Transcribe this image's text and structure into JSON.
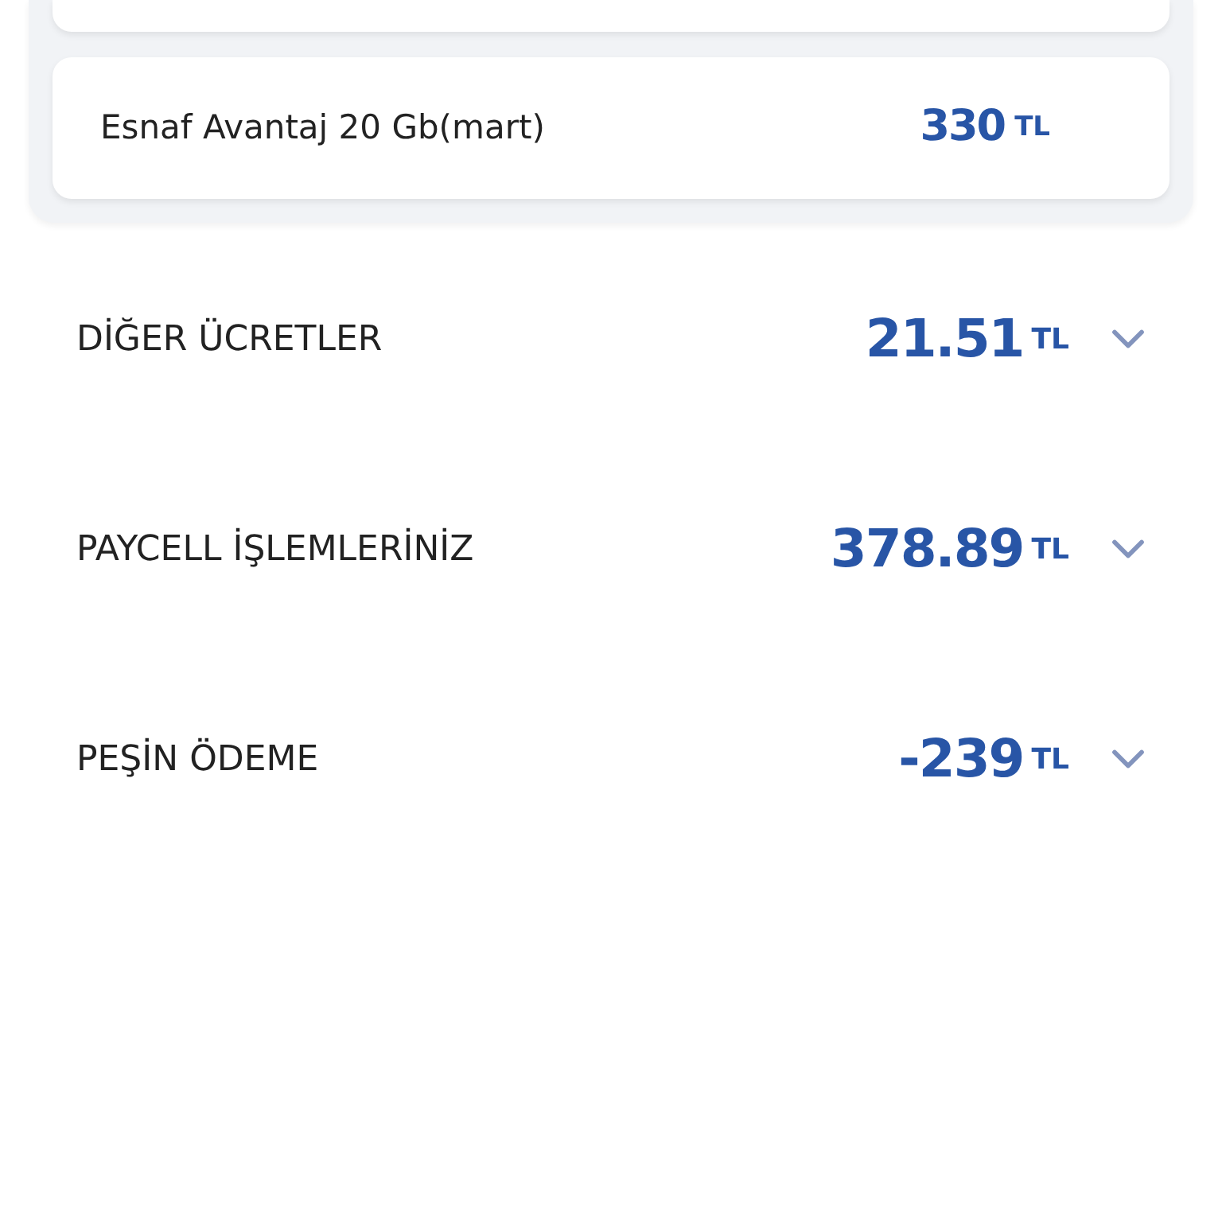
{
  "package": {
    "name": "Esnaf Avantaj 20 Gb(mart)",
    "amount": "330",
    "currency": "TL"
  },
  "sections": [
    {
      "title": "DİĞER ÜCRETLER",
      "amount": "21.51",
      "currency": "TL",
      "expanded": false
    },
    {
      "title": "PAYCELL İŞLEMLERİNİZ",
      "amount": "378.89",
      "currency": "TL",
      "expanded": false
    },
    {
      "title": "PEŞİN ÖDEME",
      "amount": "-239",
      "currency": "TL",
      "expanded": false
    }
  ]
}
